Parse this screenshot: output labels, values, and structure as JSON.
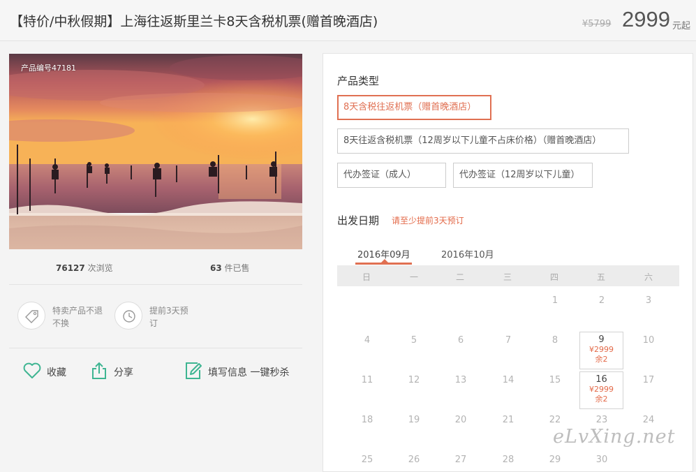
{
  "header": {
    "title": "【特价/中秋假期】上海往返斯里兰卡8天含税机票(赠首晚酒店)",
    "original_price": "¥5799",
    "price": "2999",
    "price_unit": "元起"
  },
  "photo": {
    "product_id": "产品编号47181"
  },
  "stats": {
    "views_count": "76127",
    "views_label": "次浏览",
    "sold_count": "63",
    "sold_label": "件已售"
  },
  "features": [
    {
      "icon": "tag-icon",
      "text": "特卖产品不退不换"
    },
    {
      "icon": "clock-icon",
      "text": "提前3天预订"
    }
  ],
  "actions": {
    "favorite": "收藏",
    "share": "分享",
    "fill_info": "填写信息 一键秒杀"
  },
  "product_types": {
    "title": "产品类型",
    "options": [
      "8天含税往返机票（赠首晚酒店）",
      "8天往返含税机票（12周岁以下儿童不占床价格）（赠首晚酒店）",
      "代办签证（成人）",
      "代办签证（12周岁以下儿童）"
    ],
    "selected": 0
  },
  "departure": {
    "title": "出发日期",
    "hint": "请至少提前3天预订",
    "months": [
      "2016年09月",
      "2016年10月"
    ],
    "active_month": 0,
    "weekdays": [
      "日",
      "一",
      "二",
      "三",
      "四",
      "五",
      "六"
    ],
    "weeks": [
      [
        "",
        "",
        "",
        "",
        "1",
        "2",
        "3"
      ],
      [
        "4",
        "5",
        "6",
        "7",
        "8",
        "9",
        "10"
      ],
      [
        "11",
        "12",
        "13",
        "14",
        "15",
        "16",
        "17"
      ],
      [
        "18",
        "19",
        "20",
        "21",
        "22",
        "23",
        "24"
      ],
      [
        "25",
        "26",
        "27",
        "28",
        "29",
        "30",
        ""
      ]
    ],
    "available": [
      {
        "day": "9",
        "price": "¥2999",
        "remaining": "余2"
      },
      {
        "day": "16",
        "price": "¥2999",
        "remaining": "余2"
      }
    ]
  },
  "watermark": "eLvXing.net",
  "colors": {
    "accent": "#e07052",
    "hint": "#e36a49",
    "icon_green": "#3fb592"
  }
}
